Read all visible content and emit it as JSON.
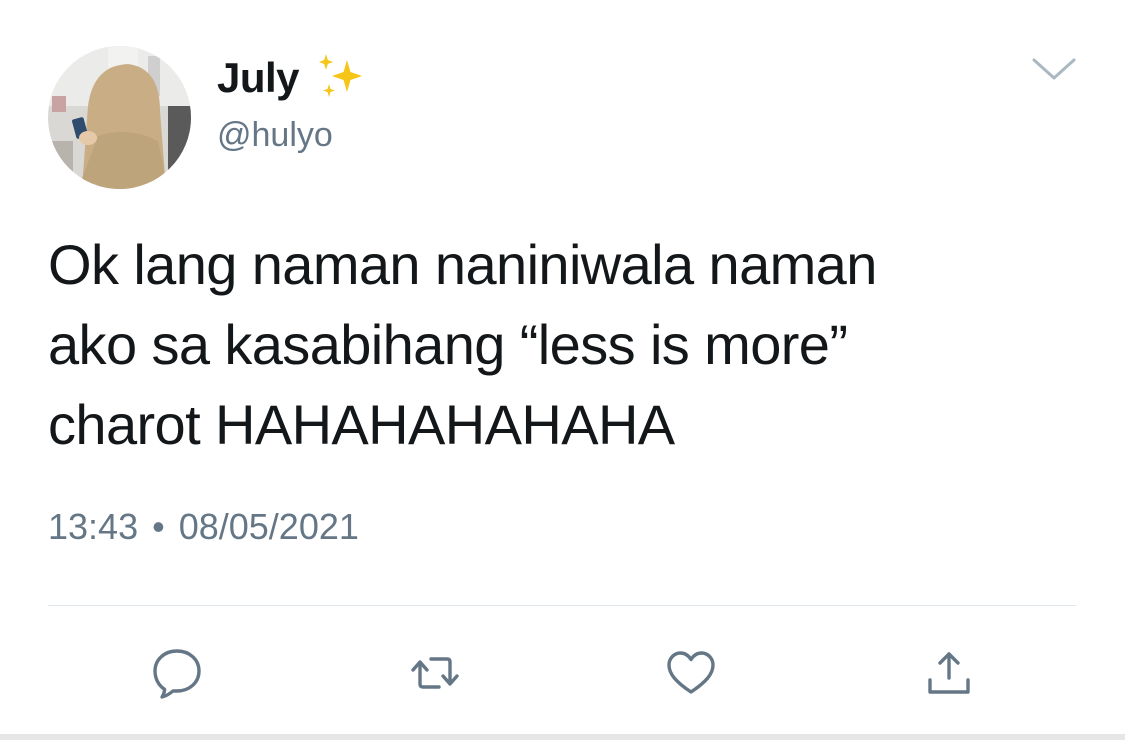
{
  "author": {
    "display_name": "July",
    "handle": "@hulyo",
    "avatar_icon": "profile-photo",
    "emoji_icon": "sparkles-icon"
  },
  "tweet": {
    "text": "Ok lang naman naniniwala naman\nako sa kasabihang “less is more”\ncharot HAHAHAHAHAHA",
    "time": "13:43",
    "separator": "•",
    "date": "08/05/2021"
  },
  "actions": [
    {
      "name": "reply",
      "icon": "reply-icon"
    },
    {
      "name": "retweet",
      "icon": "retweet-icon"
    },
    {
      "name": "like",
      "icon": "heart-icon"
    },
    {
      "name": "share",
      "icon": "share-icon"
    }
  ],
  "colors": {
    "text_primary": "#14171a",
    "text_secondary": "#657786",
    "icon": "#657786",
    "divider": "#e1e8ed",
    "sparkle": "#f5c518"
  }
}
